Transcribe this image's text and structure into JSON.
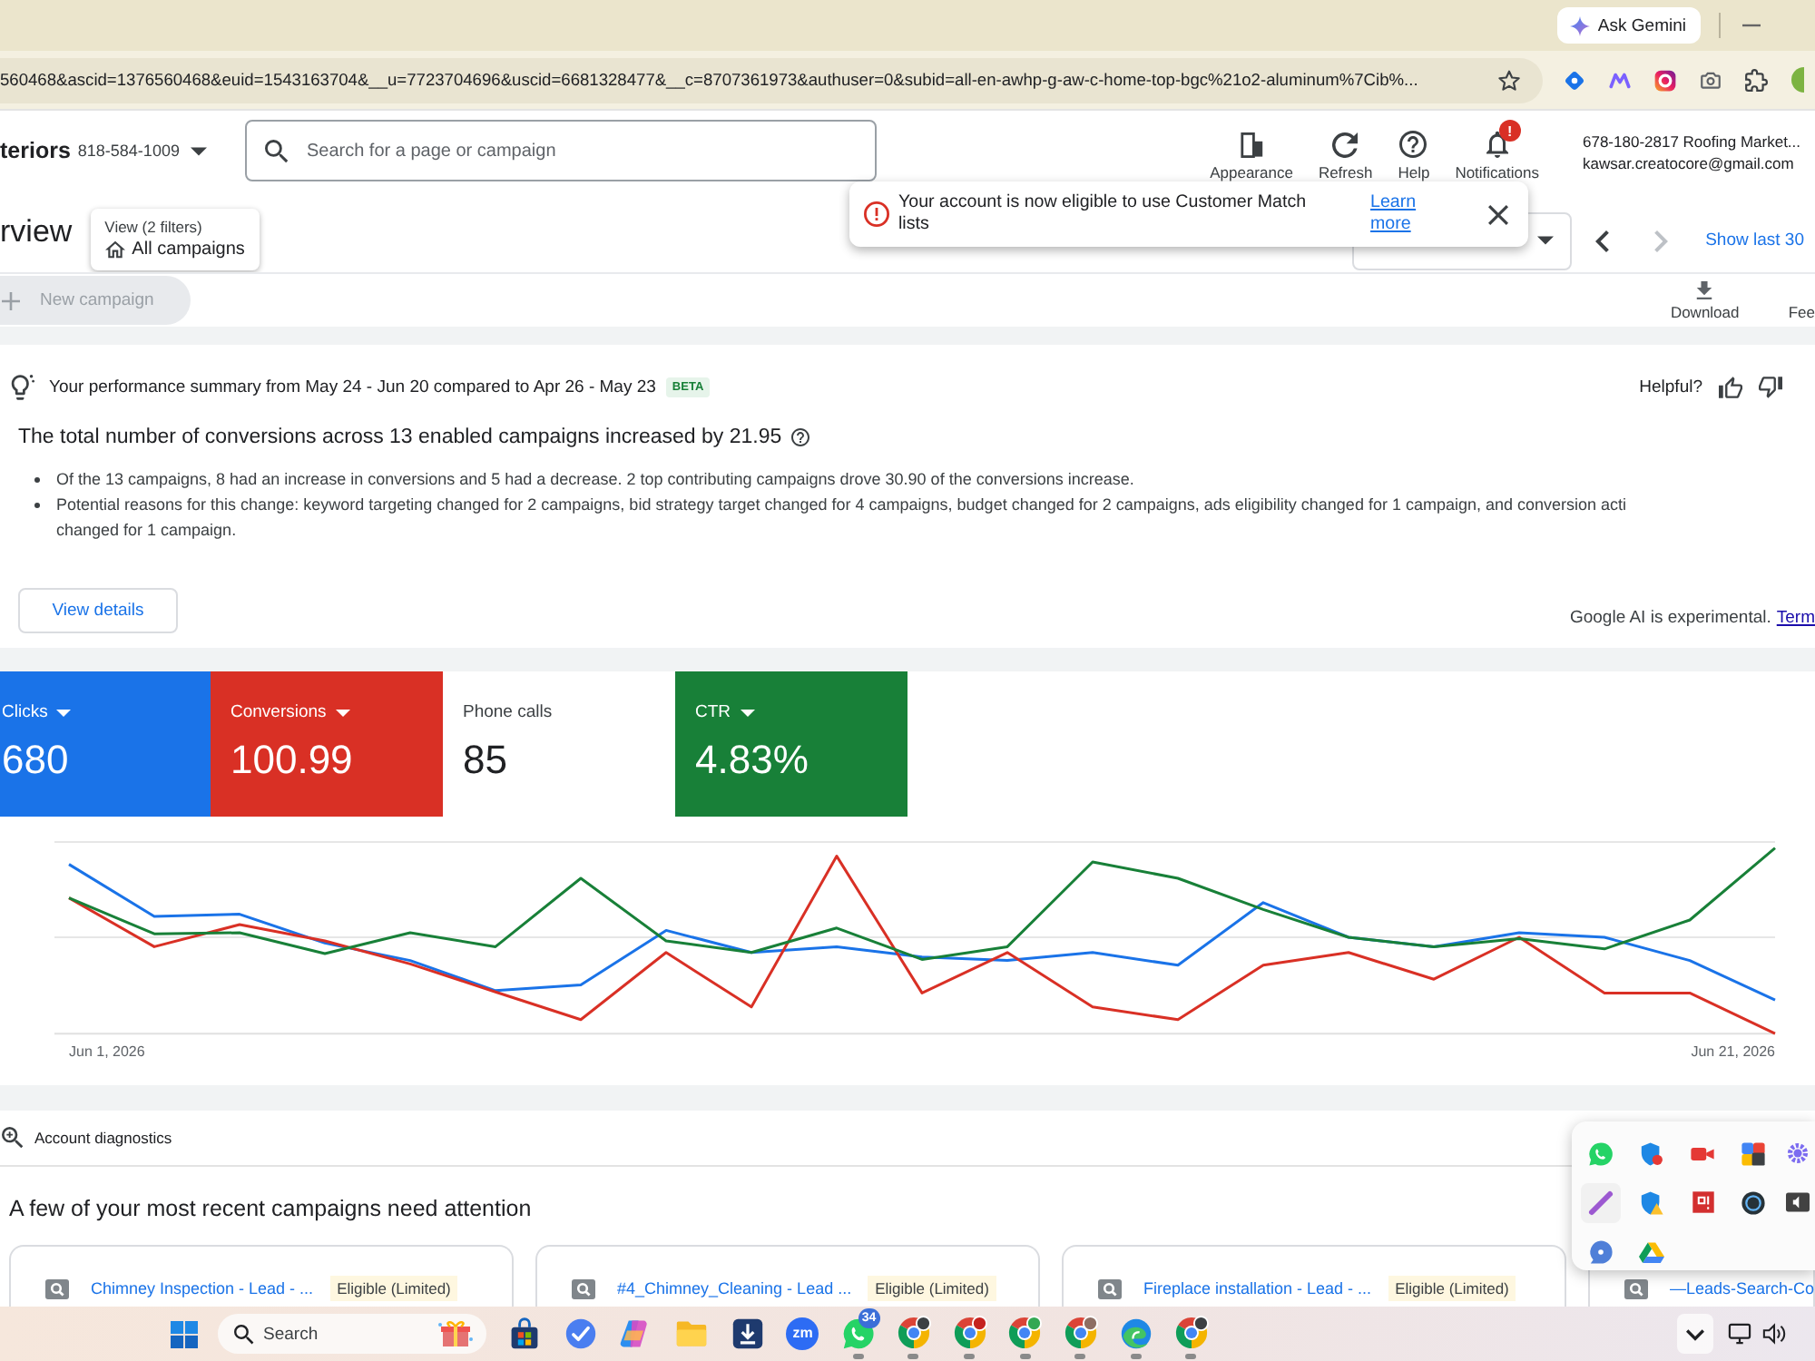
{
  "browser": {
    "ask_button": "Ask Gemini",
    "url": "560468&ascid=1376560468&euid=1543163704&__u=7723704696&uscid=6681328477&__c=8707361973&authuser=0&subid=all-en-awhp-g-aw-c-home-top-bgc%21o2-aluminum%7Cib%..."
  },
  "ads_header": {
    "account_name": "teriors",
    "account_id": "818-584-1009",
    "search": {
      "placeholder": "Search for a page or campaign"
    },
    "tools": [
      {
        "kind": "appearance",
        "label": "Appearance"
      },
      {
        "kind": "refresh",
        "label": "Refresh"
      },
      {
        "kind": "help",
        "label": "Help"
      },
      {
        "kind": "notifications",
        "label": "Notifications",
        "badge": "!"
      }
    ],
    "account": {
      "name": "678-180-2817 Roofing Market...",
      "email": "kawsar.creatocore@gmail.com"
    }
  },
  "page_header": {
    "title": "rview",
    "view_filter": {
      "caption": "View (2 filters)",
      "value": "All campaigns"
    },
    "date_nav": [
      {
        "kind": "previous",
        "disabled": false
      },
      {
        "kind": "next",
        "disabled": true
      }
    ],
    "show_last": "Show last 30",
    "new_campaign": {
      "label": "New campaign",
      "disabled": true
    },
    "actions": [
      {
        "kind": "download",
        "label": "Download"
      },
      {
        "kind": "feedback",
        "label": "Fee"
      }
    ]
  },
  "toast": {
    "message": "Your account is now eligible to use Customer Match lists",
    "link": "Learn more"
  },
  "summary": {
    "intro": "Your performance summary from May 24 - Jun 20 compared to Apr 26 - May 23",
    "badge": "BETA",
    "feedback_prompt": "Helpful?",
    "headline": "The total number of conversions across 13 enabled campaigns increased by 21.95",
    "bullets": [
      "Of the 13 campaigns, 8 had an increase in conversions and 5 had a decrease. 2 top contributing campaigns drove 30.90 of the conversions increase.",
      "Potential reasons for this change: keyword targeting changed for 2 campaigns, bid strategy target changed for 4 campaigns, budget changed for 2 campaigns, ads eligibility changed for 1 campaign, and conversion acti changed for 1 campaign."
    ],
    "button": "View details",
    "disclaimer": "Google AI is experimental.",
    "terms_link": "Term"
  },
  "metrics": [
    {
      "label": "Clicks",
      "value": "680",
      "selected": true,
      "color": "#1a73e8"
    },
    {
      "label": "Conversions",
      "value": "100.99",
      "selected": true,
      "color": "#d93025"
    },
    {
      "label": "Phone calls",
      "value": "85",
      "selected": false
    },
    {
      "label": "CTR",
      "value": "4.83%",
      "selected": true,
      "color": "#188038"
    }
  ],
  "chart": {
    "x_start": "Jun 1, 2026",
    "x_end": "Jun 21, 2026"
  },
  "diagnostics": {
    "title": "Account diagnostics",
    "heading": "A few of your most recent campaigns need attention",
    "campaigns": [
      {
        "name": "Chimney Inspection - Lead - ...",
        "status": "Eligible (Limited)"
      },
      {
        "name": "#4_Chimney_Cleaning - Lead ...",
        "status": "Eligible (Limited)"
      },
      {
        "name": "Fireplace installation - Lead - ...",
        "status": "Eligible (Limited)"
      },
      {
        "name": "—Leads-Search-Co"
      }
    ]
  },
  "taskbar": {
    "search": {
      "placeholder": "Search"
    },
    "apps": [
      {
        "kind": "store",
        "running": false
      },
      {
        "kind": "todo",
        "running": false
      },
      {
        "kind": "assistant",
        "running": false
      },
      {
        "kind": "folder",
        "running": false
      },
      {
        "kind": "download",
        "running": false
      },
      {
        "kind": "meeting",
        "label": "zm",
        "running": false
      },
      {
        "kind": "chat",
        "badge": "34",
        "running": true
      },
      {
        "kind": "browser",
        "color": "#3c4043",
        "running": true
      },
      {
        "kind": "browser",
        "color": "#c5221f",
        "running": true
      },
      {
        "kind": "browser",
        "color": "#34a853",
        "running": true
      },
      {
        "kind": "browser",
        "color": "#8d6e63",
        "running": true
      },
      {
        "kind": "wave",
        "running": true
      },
      {
        "kind": "browser",
        "color": "#3c4043",
        "running": true
      }
    ],
    "tray_expanded": true
  }
}
